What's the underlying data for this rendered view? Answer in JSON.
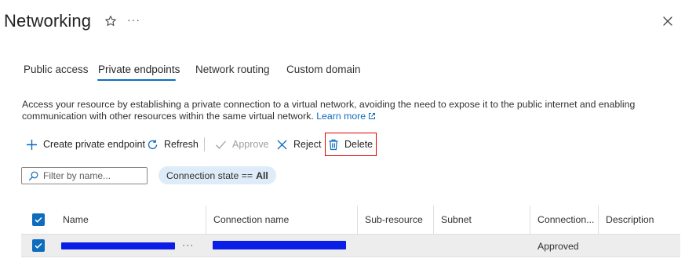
{
  "header": {
    "title": "Networking",
    "more": "···"
  },
  "tabs": [
    {
      "label": "Public access",
      "active": false
    },
    {
      "label": "Private endpoints",
      "active": true
    },
    {
      "label": "Network routing",
      "active": false
    },
    {
      "label": "Custom domain",
      "active": false
    }
  ],
  "description": {
    "text": "Access your resource by establishing a private connection to a virtual network, avoiding the need to expose it to the public internet and enabling communication with other resources within the same virtual network.",
    "link": "Learn more"
  },
  "toolbar": {
    "create": "Create private endpoint",
    "refresh": "Refresh",
    "approve": "Approve",
    "reject": "Reject",
    "delete": "Delete"
  },
  "filter": {
    "placeholder": "Filter by name...",
    "pill_label": "Connection state ==",
    "pill_value": "All"
  },
  "table": {
    "columns": [
      "Name",
      "Connection name",
      "Sub-resource",
      "Subnet",
      "Connection...",
      "Description"
    ],
    "rows": [
      {
        "name": "",
        "row_more": "···",
        "connection_name": "",
        "sub_resource": "",
        "subnet": "",
        "connection_state": "Approved",
        "description": "",
        "selected": true
      }
    ]
  },
  "colors": {
    "accent": "#0f6cbd",
    "highlight_box": "#e00000",
    "redaction": "#0b1ee8"
  },
  "icons": [
    "star-icon",
    "close-icon",
    "external-link-icon",
    "add-icon",
    "refresh-icon",
    "check-icon",
    "x-icon",
    "trash-icon",
    "search-icon",
    "checkbox-icon"
  ]
}
